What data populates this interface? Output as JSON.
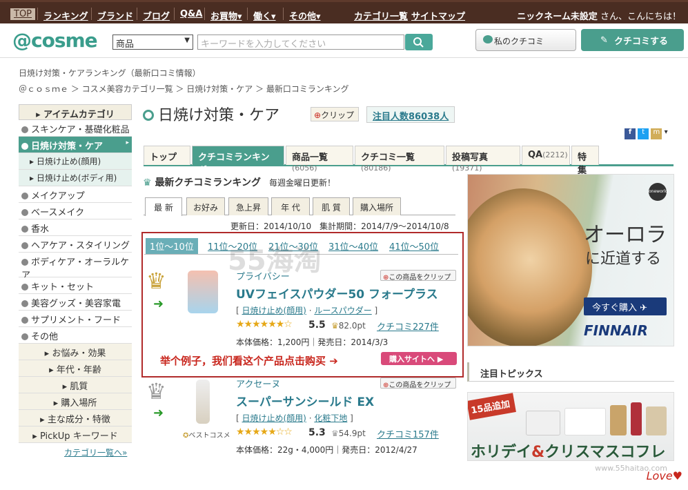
{
  "topnav": {
    "items": [
      "TOP",
      "ランキング",
      "ブランド",
      "ブログ",
      "Q&A",
      "お買物▾",
      "働く▾",
      "その他▾",
      "カテゴリ一覧",
      "サイトマップ"
    ],
    "user": "ニックネーム未設定",
    "greeting": " さん、こんにちは！"
  },
  "header": {
    "logo": "@cosme",
    "select_value": "商品",
    "search_placeholder": "キーワードを入力してください",
    "my_kuchikomi": "私のクチコミ",
    "write_kuchikomi": "クチコミする"
  },
  "breadcrumb": {
    "line1": "日焼け対策・ケアランキング（最新口コミ情報）",
    "line2": "＠ｃｏｓｍｅ ＞ コスメ美容カテゴリ一覧 ＞ 日焼け対策・ケア ＞ 最新口コミランキング"
  },
  "sidebar": {
    "head": "アイテムカテゴリ",
    "items": [
      {
        "label": "スキンケア・基礎化粧品"
      },
      {
        "label": "日焼け対策・ケア"
      },
      {
        "label": "日焼け止め(顔用)"
      },
      {
        "label": "日焼け止め(ボディ用)"
      },
      {
        "label": "メイクアップ"
      },
      {
        "label": "ベースメイク"
      },
      {
        "label": "香水"
      },
      {
        "label": "ヘアケア・スタイリング"
      },
      {
        "label": "ボディケア・オーラルケア"
      },
      {
        "label": "キット・セット"
      },
      {
        "label": "美容グッズ・美容家電"
      },
      {
        "label": "サプリメント・フード"
      },
      {
        "label": "その他"
      },
      {
        "label": "お悩み・効果"
      },
      {
        "label": "年代・年齢"
      },
      {
        "label": "肌質"
      },
      {
        "label": "購入場所"
      },
      {
        "label": "主な成分・特徴"
      },
      {
        "label": "PickUp キーワード"
      }
    ],
    "more_link": "カテゴリ一覧へ»"
  },
  "page": {
    "title": "日焼け対策・ケア",
    "clip": "クリップ",
    "attention": "注目人数86038人"
  },
  "tabs": [
    {
      "label": "トップ",
      "count": ""
    },
    {
      "label": "クチコミランキング",
      "count": ""
    },
    {
      "label": "商品一覧",
      "count": "(6056)"
    },
    {
      "label": "クチコミ一覧",
      "count": "(80186)"
    },
    {
      "label": "投稿写真",
      "count": "(19371)"
    },
    {
      "label": "QA",
      "count": "(2212)"
    },
    {
      "label": "特集",
      "count": ""
    }
  ],
  "ranking": {
    "title": "最新クチコミランキング",
    "note": "毎週金曜日更新！",
    "subtabs": [
      "最 新",
      "お好み",
      "急上昇",
      "年 代",
      "肌 質",
      "購入場所"
    ],
    "dates": "更新日：2014/10/10　集計期間：2014/7/9～2014/10/8",
    "pages": [
      "1位～10位",
      "11位～20位",
      "21位～30位",
      "31位～40位",
      "41位～50位"
    ],
    "items": [
      {
        "rank": "1",
        "brand": "プライバシー",
        "name": "UVフェイスパウダー50 フォープラス",
        "cat1": "日焼け止め(顔用)",
        "cat2": "ルースパウダー",
        "stars": "★★★★★★☆",
        "score": "5.5",
        "pt": "82.0pt",
        "kuchikomi": "クチコミ227件",
        "price": "本体価格：1,200円｜発売日：2014/3/3",
        "clip": "この商品をクリップ"
      },
      {
        "rank": "2",
        "brand": "アクセーヌ",
        "name": "スーパーサンシールド EX",
        "cat1": "日焼け止め(顔用)",
        "cat2": "化粧下地",
        "stars": "★★★★★☆☆",
        "score": "5.3",
        "pt": "54.9pt",
        "kuchikomi": "クチコミ157件",
        "price": "本体価格：22g・4,000円｜発売日：2012/4/27",
        "clip": "この商品をクリップ"
      }
    ],
    "annotation": "举个例子，我们看这个产品点击购买 ➔",
    "buy_button": "購入サイトへ ▶",
    "best_cosme": "ベストコスメ"
  },
  "ad": {
    "headline1": "オーロラ",
    "headline2": "に近道する",
    "button": "今すぐ購入 ✈",
    "brand": "FINNAIR",
    "badge": "oneworld"
  },
  "topics": {
    "title": "注目トピックス",
    "badge": "15品追加",
    "banner_a": "ホリデイ",
    "banner_amp": "&",
    "banner_b": "クリスマスコフレ"
  },
  "watermarks": {
    "center": "55海淘",
    "site": "www.55haitao.com",
    "love": "Love"
  },
  "colors": {
    "brand_green": "#4a9e8d",
    "topnav_brown": "#4a2d22",
    "link": "#2a7a8c",
    "annotation_red": "#c8261d"
  }
}
